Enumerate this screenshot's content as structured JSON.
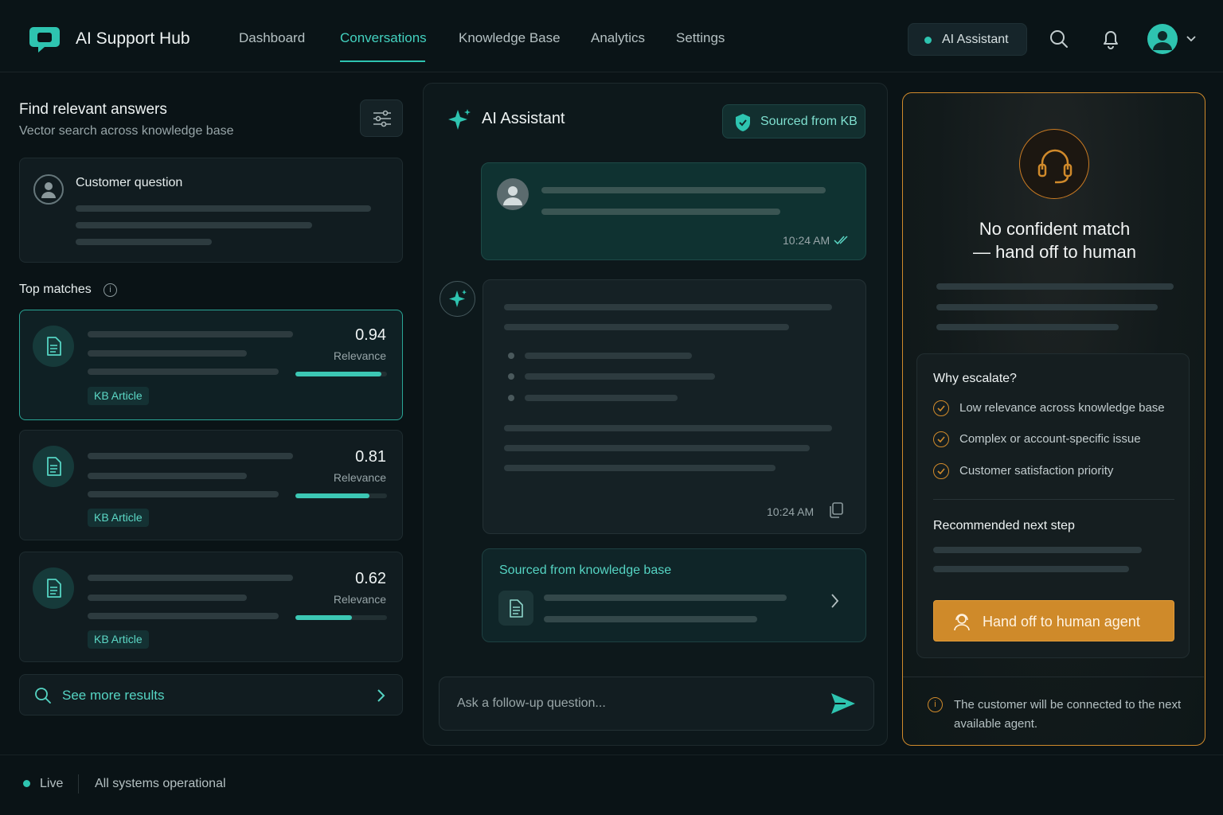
{
  "header": {
    "brand": "AI Support Hub",
    "nav": [
      {
        "label": "Dashboard"
      },
      {
        "label": "Conversations",
        "active": true
      },
      {
        "label": "Knowledge Base"
      },
      {
        "label": "Analytics"
      },
      {
        "label": "Settings"
      }
    ],
    "assistant_pill": "AI Assistant",
    "icons": [
      "chat-logo-icon",
      "search-icon",
      "bell-icon",
      "user-avatar",
      "chevron-down-icon"
    ]
  },
  "search_panel": {
    "title": "Find relevant answers",
    "subtitle": "Vector search across knowledge base",
    "question_label": "Customer question",
    "top_matches_label": "Top matches",
    "matches": [
      {
        "score": "0.94",
        "relevance_label": "Relevance",
        "relevance": 0.94,
        "tag": "KB Article"
      },
      {
        "score": "0.81",
        "relevance_label": "Relevance",
        "relevance": 0.81,
        "tag": "KB Article"
      },
      {
        "score": "0.62",
        "relevance_label": "Relevance",
        "relevance": 0.62,
        "tag": "KB Article"
      }
    ],
    "see_more": "See more results"
  },
  "chat": {
    "title": "AI Assistant",
    "badge": "Sourced from KB",
    "user_time": "10:24 AM",
    "ai_time": "10:24 AM",
    "source_title": "Sourced from knowledge base",
    "input_placeholder": "Ask a follow-up question..."
  },
  "escalation": {
    "title_line1": "No confident match",
    "title_line2": "— hand off to human",
    "why_title": "Why escalate?",
    "reasons": [
      "Low relevance across knowledge base",
      "Complex or account-specific issue",
      "Customer satisfaction priority"
    ],
    "next_step_title": "Recommended next step",
    "button": "Hand off to human agent",
    "note": "The customer will be connected to the next available agent.",
    "accent": "#cf8a2a"
  },
  "footer": {
    "live": "Live",
    "status": "All systems operational"
  },
  "colors": {
    "teal": "#2ec4b0",
    "orange": "#cf8a2a",
    "bg": "#0a1316"
  }
}
